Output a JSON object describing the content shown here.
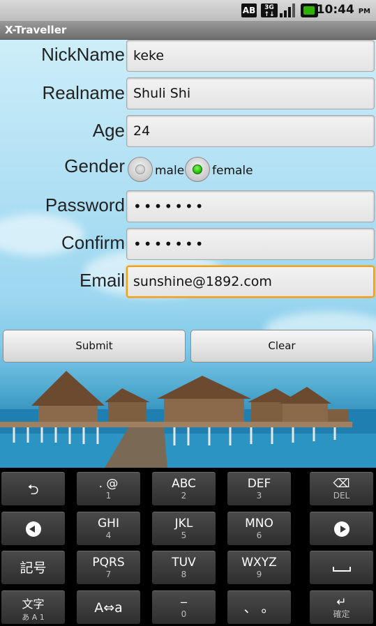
{
  "status_bar": {
    "ab_icon": "AB",
    "network_icon": "3G",
    "time": "10:44",
    "ampm": "PM",
    "battery_color": "#2fb300"
  },
  "app": {
    "title": "X-Traveller"
  },
  "form": {
    "nickname": {
      "label": "NickName",
      "value": "keke"
    },
    "realname": {
      "label": "Realname",
      "value": "Shuli Shi"
    },
    "age": {
      "label": "Age",
      "value": "24"
    },
    "gender": {
      "label": "Gender",
      "options": [
        {
          "label": "male",
          "selected": false
        },
        {
          "label": "female",
          "selected": true
        }
      ]
    },
    "password": {
      "label": "Password",
      "value": "•••••••"
    },
    "confirm": {
      "label": "Confirm",
      "value": "•••••••"
    },
    "email": {
      "label": "Email",
      "value": "sunshine@1892.com"
    }
  },
  "buttons": {
    "submit": "Submit",
    "clear": "Clear"
  },
  "keyboard": {
    "rows": [
      [
        {
          "icon": "undo-icon"
        },
        {
          "main": ". @",
          "sub": "1"
        },
        {
          "main": "ABC",
          "sub": "2"
        },
        {
          "main": "DEF",
          "sub": "3"
        },
        {
          "icon": "delete-icon",
          "sub": "DEL"
        }
      ],
      [
        {
          "icon": "left-arrow-icon"
        },
        {
          "main": "GHI",
          "sub": "4"
        },
        {
          "main": "JKL",
          "sub": "5"
        },
        {
          "main": "MNO",
          "sub": "6"
        },
        {
          "icon": "right-arrow-icon"
        }
      ],
      [
        {
          "main": "記号"
        },
        {
          "main": "PQRS",
          "sub": "7"
        },
        {
          "main": "TUV",
          "sub": "8"
        },
        {
          "main": "WXYZ",
          "sub": "9"
        },
        {
          "icon": "space-icon"
        }
      ],
      [
        {
          "main": "文字",
          "sub": "あ A 1"
        },
        {
          "main": "A⇔a"
        },
        {
          "main": "‒",
          "sub": "0"
        },
        {
          "main": "、 。"
        },
        {
          "icon": "enter-icon",
          "sub": "確定"
        }
      ]
    ]
  }
}
